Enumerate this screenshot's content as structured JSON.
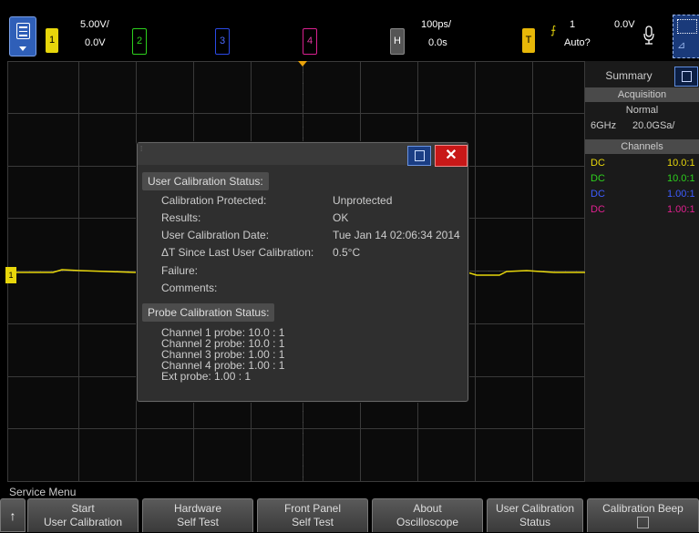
{
  "topbar": {
    "ch1_label": "1",
    "ch1_scale": "5.00V/",
    "ch1_offset": "0.0V",
    "ch2_label": "2",
    "ch3_label": "3",
    "ch4_label": "4",
    "h_label": "H",
    "timebase": "100ps/",
    "delay": "0.0s",
    "trigger_label": "T",
    "trigger_source": "1",
    "trigger_level": "0.0V",
    "trigger_mode": "Auto?",
    "icons": [
      "menu-icon",
      "trigger-edge-icon",
      "microphone-icon",
      "touch-select-icon"
    ]
  },
  "panel": {
    "tab_label": "Summary",
    "acquisition_title": "Acquisition",
    "acq_mode": "Normal",
    "bandwidth": "6GHz",
    "sample_rate": "20.0GSa/",
    "channels_title": "Channels",
    "channels": [
      {
        "coupling": "DC",
        "probe": "10.0:1",
        "color": "#e7d60b"
      },
      {
        "coupling": "DC",
        "probe": "10.0:1",
        "color": "#2dd01d"
      },
      {
        "coupling": "DC",
        "probe": "1.00:1",
        "color": "#3d5cff"
      },
      {
        "coupling": "DC",
        "probe": "1.00:1",
        "color": "#e0208f"
      }
    ]
  },
  "dialog": {
    "user_cal_header": "User Calibration Status:",
    "rows": [
      {
        "label": "Calibration Protected:",
        "value": "Unprotected"
      },
      {
        "label": "Results:",
        "value": "OK"
      },
      {
        "label": "User Calibration Date:",
        "value": "Tue Jan 14 02:06:34 2014"
      },
      {
        "label": "ΔT Since Last User Calibration:",
        "value": "0.5°C"
      },
      {
        "label": "Failure:",
        "value": ""
      },
      {
        "label": "Comments:",
        "value": ""
      }
    ],
    "probe_cal_header": "Probe Calibration Status:",
    "probes": [
      "Channel 1 probe: 10.0 : 1",
      "Channel 2 probe: 10.0 : 1",
      "Channel 3 probe: 1.00 : 1",
      "Channel 4 probe: 1.00 : 1",
      "Ext probe: 1.00 : 1"
    ]
  },
  "waveform": {
    "ground_marker": "1"
  },
  "menu": {
    "title": "Service Menu",
    "softkeys": [
      {
        "line1": "Start",
        "line2": "User Calibration"
      },
      {
        "line1": "Hardware",
        "line2": "Self Test"
      },
      {
        "line1": "Front Panel",
        "line2": "Self Test"
      },
      {
        "line1": "About",
        "line2": "Oscilloscope"
      },
      {
        "line1": "User Calibration",
        "line2": "Status"
      },
      {
        "line1": "Calibration Beep",
        "line2": ""
      }
    ],
    "back_arrow": "↑"
  },
  "colors": {
    "ch1": "#e7d60b",
    "ch2": "#2dd01d",
    "ch3": "#2a49e6",
    "ch4": "#d9208f",
    "accent": "#2f5fb8",
    "close": "#c81818"
  }
}
